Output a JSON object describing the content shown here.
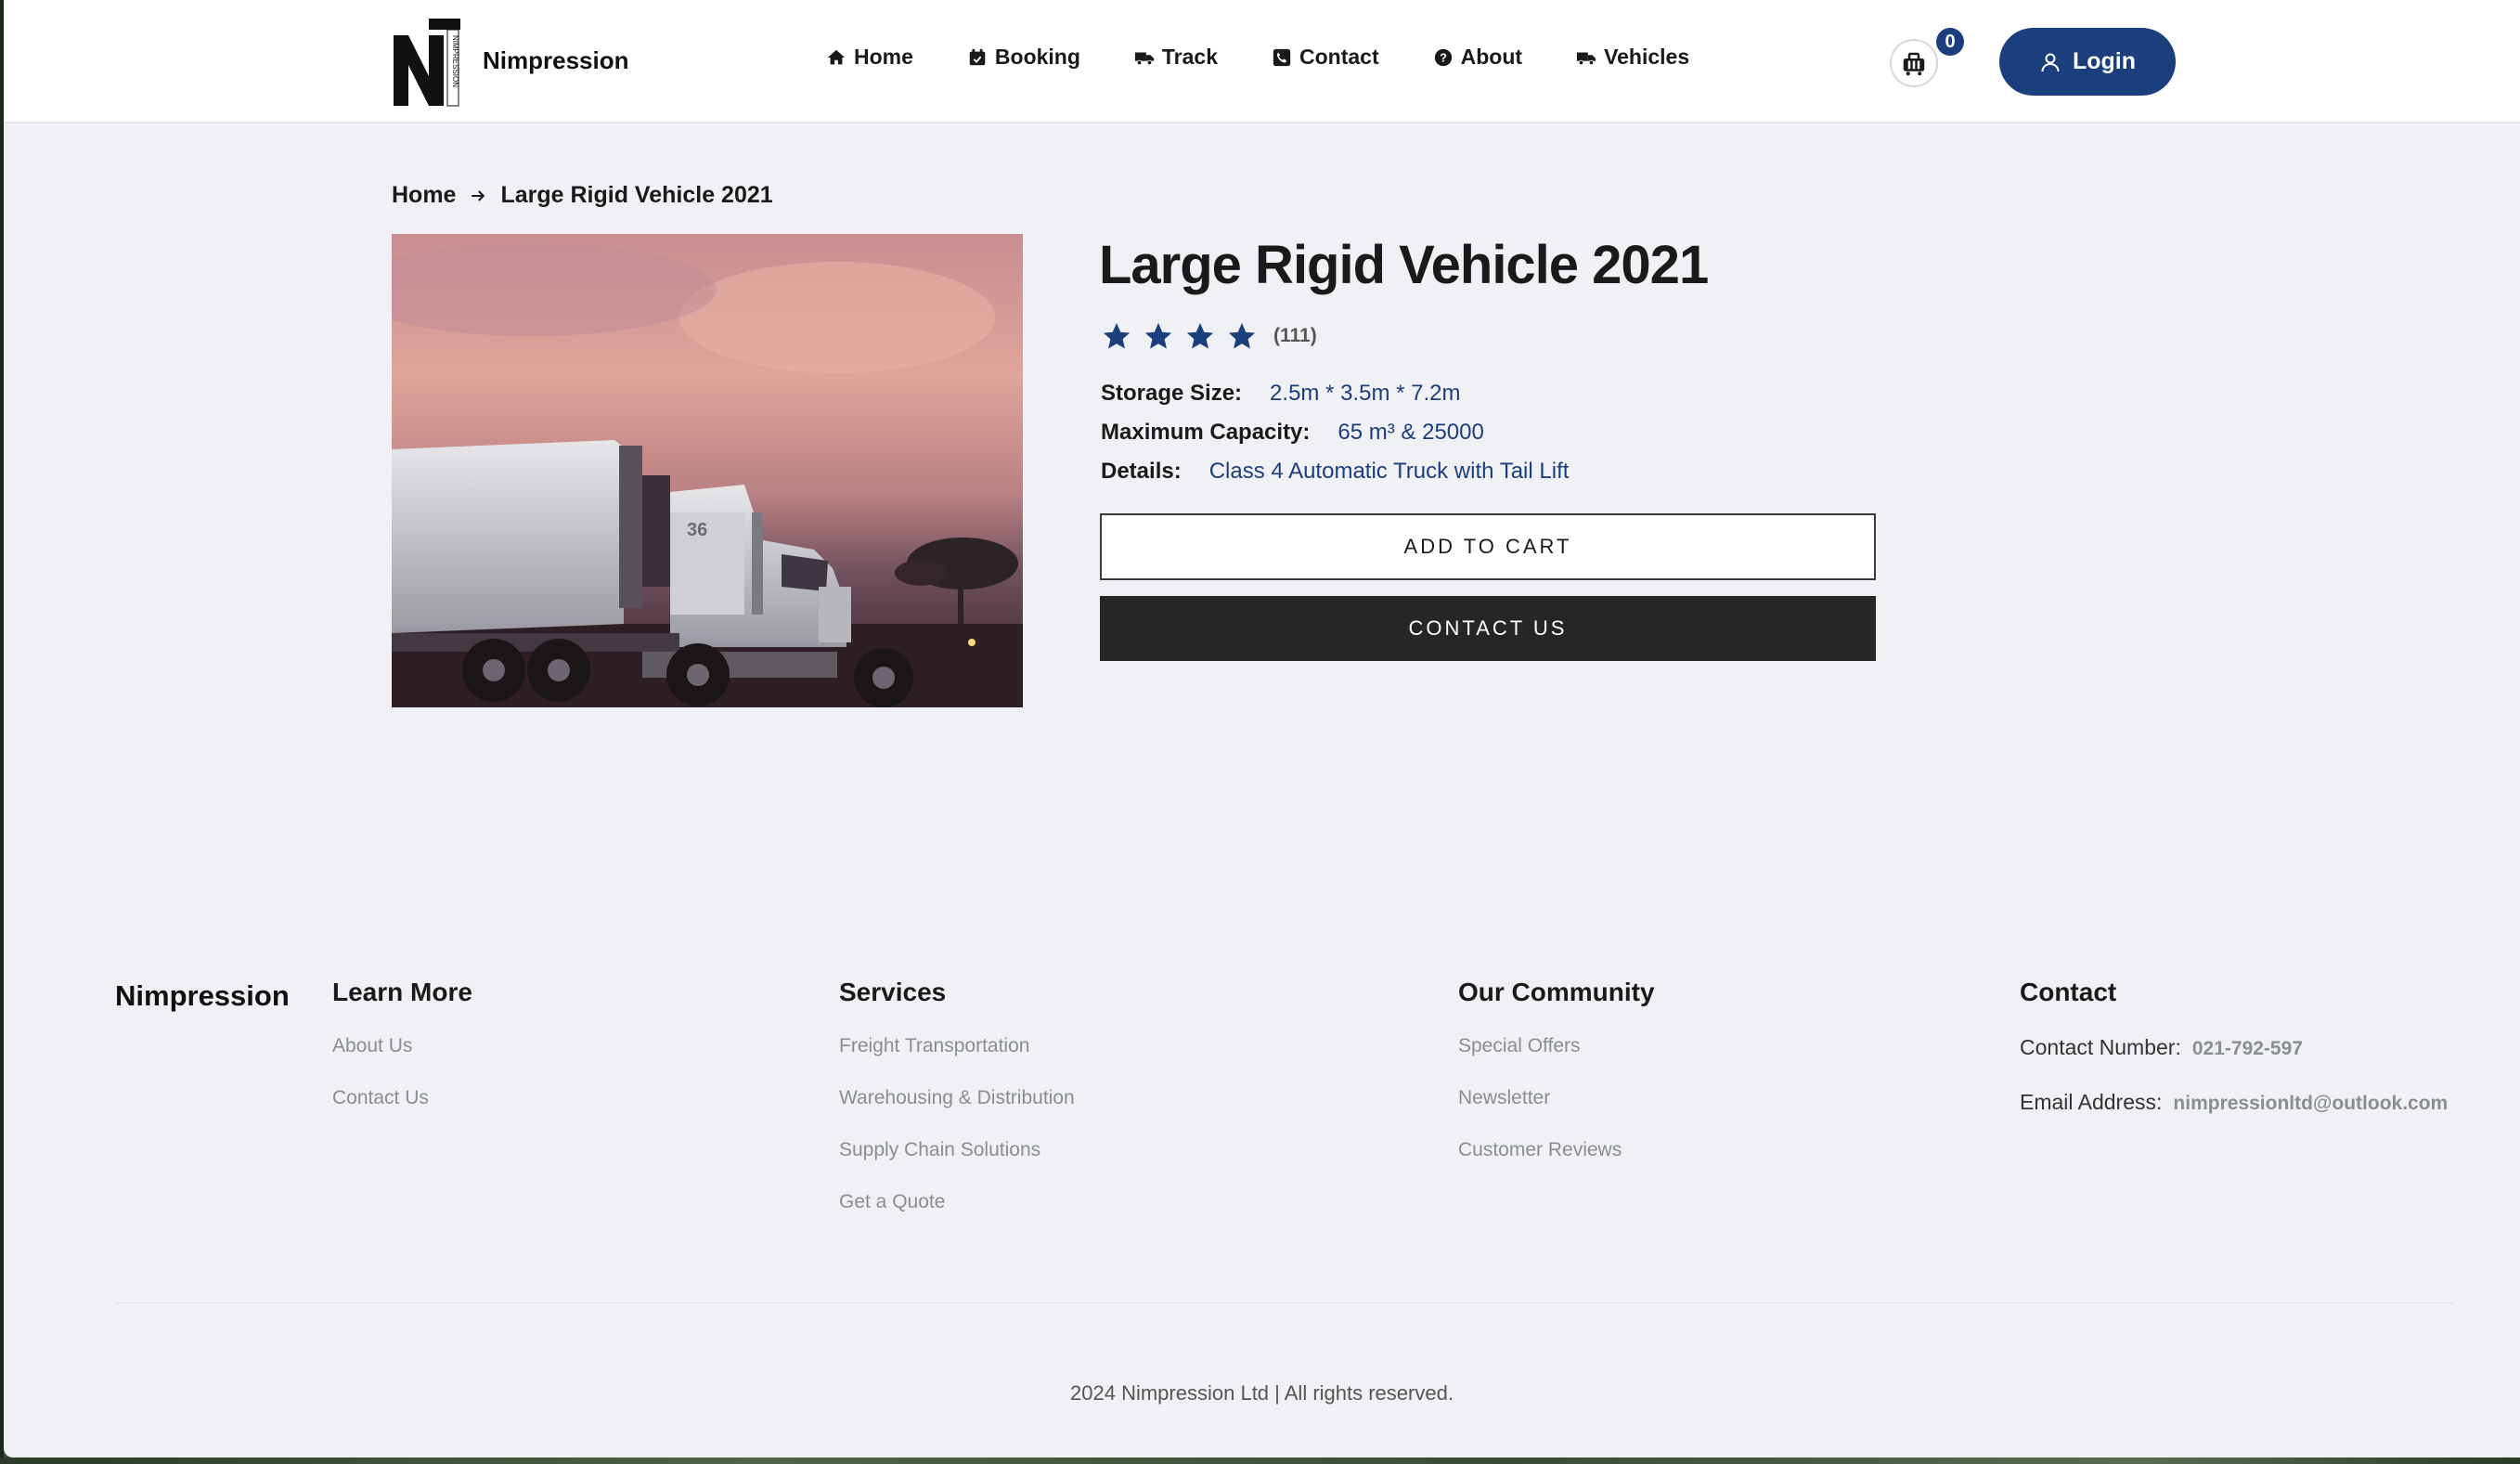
{
  "header": {
    "brand": "Nimpression",
    "logo_letters": "N",
    "logo_vertical_text": "NIMPRESSION",
    "nav": [
      {
        "label": "Home",
        "icon": "home-icon"
      },
      {
        "label": "Booking",
        "icon": "calendar-icon"
      },
      {
        "label": "Track",
        "icon": "truck-icon"
      },
      {
        "label": "Contact",
        "icon": "phone-icon"
      },
      {
        "label": "About",
        "icon": "question-icon"
      },
      {
        "label": "Vehicles",
        "icon": "truck-icon"
      }
    ],
    "cart_count": "0",
    "login_label": "Login"
  },
  "breadcrumb": {
    "home": "Home",
    "current": "Large Rigid Vehicle 2021"
  },
  "product": {
    "title": "Large Rigid Vehicle 2021",
    "rating_stars": 4,
    "rating_count": "(111)",
    "image_label": "36",
    "specs": [
      {
        "label": "Storage Size:",
        "value": "2.5m * 3.5m * 7.2m"
      },
      {
        "label": "Maximum Capacity:",
        "value": "65 m³ & 25000"
      },
      {
        "label": "Details:",
        "value": "Class 4 Automatic Truck with Tail Lift"
      }
    ],
    "add_to_cart": "ADD TO CART",
    "contact_us": "CONTACT US"
  },
  "footer": {
    "brand": "Nimpression",
    "learn_more": {
      "title": "Learn More",
      "links": [
        "About Us",
        "Contact Us"
      ]
    },
    "services": {
      "title": "Services",
      "links": [
        "Freight Transportation",
        "Warehousing & Distribution",
        "Supply Chain Solutions",
        "Get a Quote"
      ]
    },
    "community": {
      "title": "Our Community",
      "links": [
        "Special Offers",
        "Newsletter",
        "Customer Reviews"
      ]
    },
    "contact": {
      "title": "Contact",
      "phone_label": "Contact Number:",
      "phone": "021-792-597",
      "email_label": "Email Address:",
      "email": "nimpressionltd@outlook.com"
    },
    "copyright": "2024 Nimpression Ltd | All rights reserved."
  },
  "colors": {
    "primary": "#1b3f7d",
    "dark_button": "#252724",
    "page_bg": "#f0f1f5"
  }
}
